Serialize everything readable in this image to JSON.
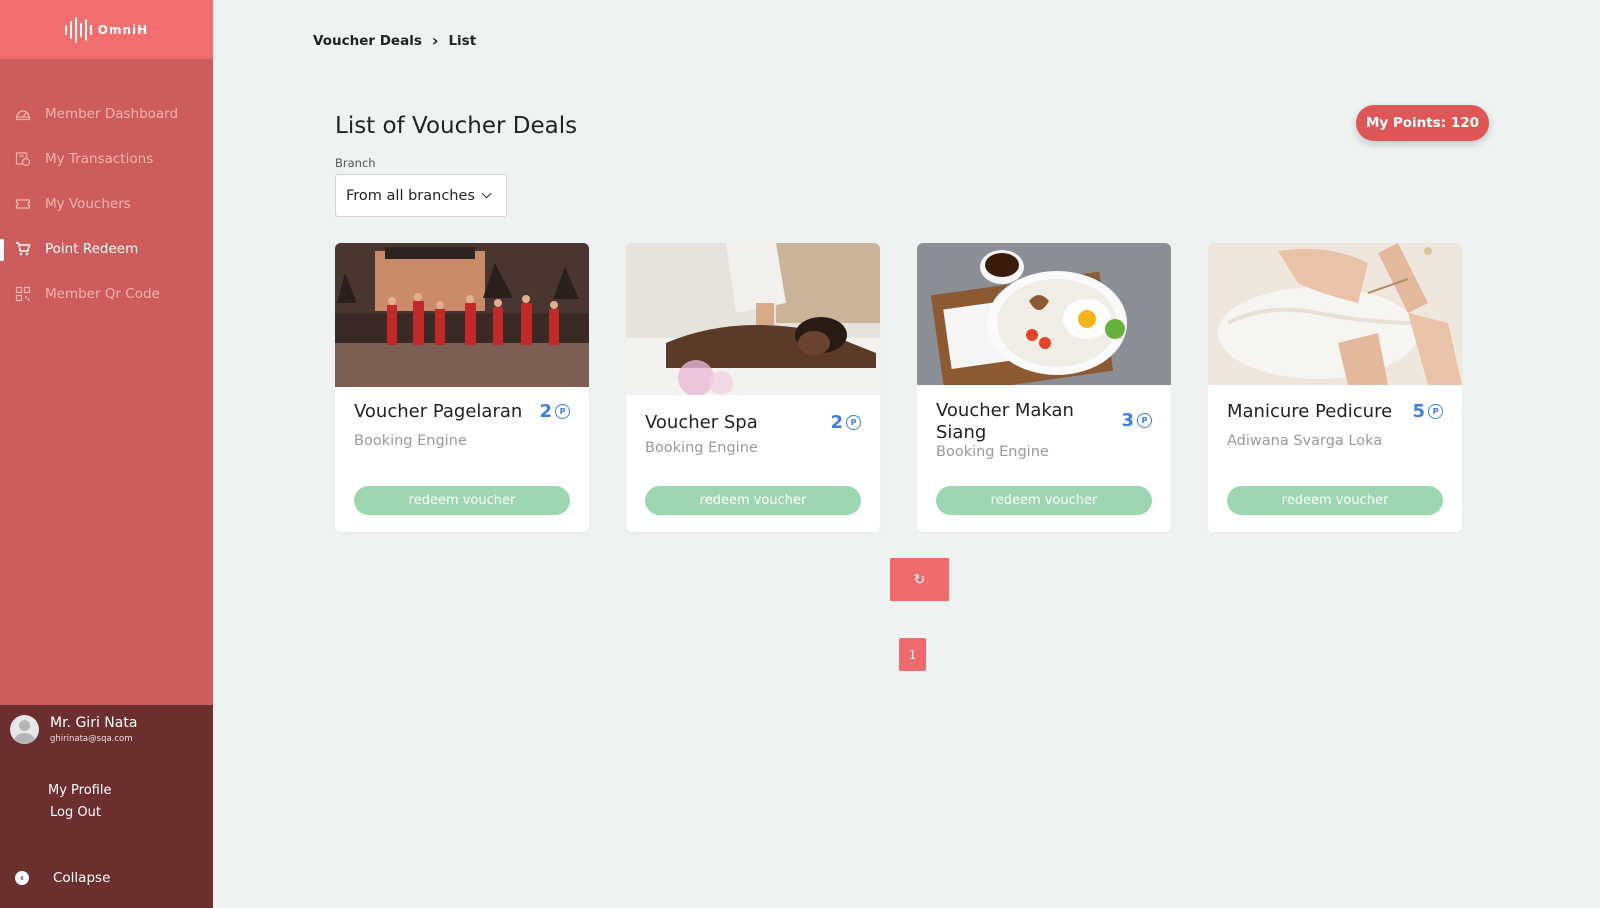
{
  "app": {
    "logo_text": "OmniH"
  },
  "sidebar": {
    "items": [
      {
        "label": "Member Dashboard",
        "icon": "dashboard-icon",
        "active": false
      },
      {
        "label": "My Transactions",
        "icon": "transactions-icon",
        "active": false
      },
      {
        "label": "My Vouchers",
        "icon": "voucher-icon",
        "active": false
      },
      {
        "label": "Point Redeem",
        "icon": "cart-icon",
        "active": true
      },
      {
        "label": "Member Qr Code",
        "icon": "qr-code-icon",
        "active": false
      }
    ]
  },
  "user": {
    "name": "Mr. Giri Nata",
    "email": "ghirinata@sqa.com",
    "profile_label": "My Profile",
    "logout_label": "Log Out",
    "collapse_label": "Collapse"
  },
  "breadcrumb": {
    "parent": "Voucher Deals",
    "current": "List"
  },
  "main": {
    "title": "List of Voucher Deals",
    "points_label": "My Points: 120",
    "branch_label": "Branch",
    "branch_selected": "From all branches"
  },
  "vouchers": [
    {
      "title": "Voucher Pagelaran",
      "points": "2",
      "subtitle": "Booking Engine",
      "button": "redeem voucher"
    },
    {
      "title": "Voucher Spa",
      "points": "2",
      "subtitle": "Booking Engine",
      "button": "redeem voucher"
    },
    {
      "title": "Voucher Makan Siang",
      "points": "3",
      "subtitle": "Booking Engine",
      "button": "redeem voucher"
    },
    {
      "title": "Manicure Pedicure",
      "points": "5",
      "subtitle": "Adiwana Svarga Loka",
      "button": "redeem voucher"
    }
  ],
  "pagination": {
    "refresh_symbol": "↻",
    "current_page": "1"
  },
  "colors": {
    "sidebar": "#cd5c5c",
    "logo_bar": "#f26d6d",
    "user_panel": "#6b2f2f",
    "points_accent": "#3c7fe0",
    "redeem_button": "#9dd7b2",
    "badge": "#de5656"
  }
}
